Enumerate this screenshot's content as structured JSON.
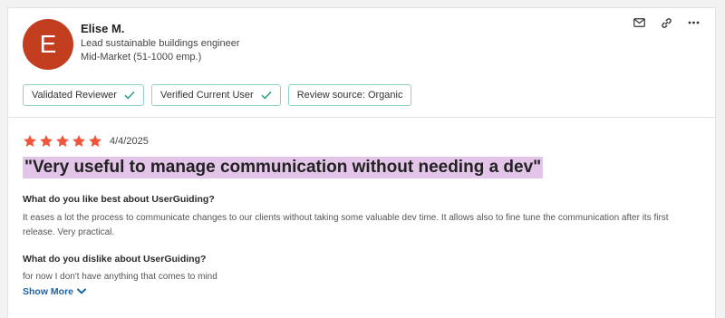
{
  "reviewer": {
    "initial": "E",
    "name": "Elise M.",
    "title": "Lead sustainable buildings engineer",
    "segment": "Mid-Market (51-1000 emp.)",
    "avatar_color": "#c33d1f"
  },
  "actions": {
    "icons": [
      "mail-icon",
      "link-icon",
      "more-icon"
    ]
  },
  "badges": [
    {
      "label": "Validated Reviewer",
      "checked": true
    },
    {
      "label": "Verified Current User",
      "checked": true
    },
    {
      "label": "Review source: Organic",
      "checked": false
    }
  ],
  "review": {
    "rating": 5,
    "rating_max": 5,
    "star_color": "#f0553a",
    "date": "4/4/2025",
    "headline": "\"Very useful to manage communication without needing a dev\"",
    "headline_highlight": "#e3c5e9",
    "q1": "What do you like best about UserGuiding?",
    "a1": "It eases a lot the process to communicate changes to our clients without taking some valuable dev time. It allows also to fine tune the communication after its first release. Very practical.",
    "q2": "What do you dislike about UserGuiding?",
    "a2": "for now I don't have anything that comes to mind",
    "show_more": "Show More"
  },
  "colors": {
    "badge_border": "#8fd0c2",
    "check": "#2a9d84",
    "link": "#1b63a8"
  }
}
